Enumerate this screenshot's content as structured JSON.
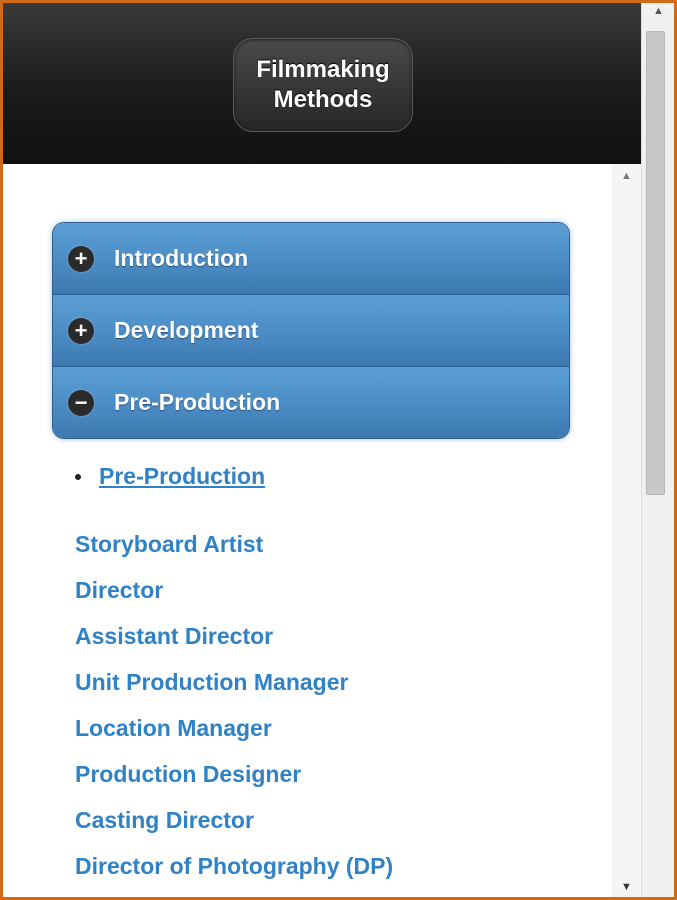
{
  "header": {
    "title": "Filmmaking\nMethods"
  },
  "accordion": [
    {
      "label": "Introduction",
      "icon": "plus-icon",
      "symbol": "+"
    },
    {
      "label": "Development",
      "icon": "plus-icon",
      "symbol": "+"
    },
    {
      "label": "Pre-Production",
      "icon": "minus-icon",
      "symbol": "−"
    }
  ],
  "content": {
    "bullet_link": "Pre-Production",
    "links": [
      "Storyboard Artist",
      "Director",
      "Assistant Director",
      "Unit Production Manager",
      "Location Manager",
      "Production Designer",
      "Casting Director",
      "Director of Photography (DP)"
    ]
  },
  "scrollbar": {
    "up": "▲",
    "down": "▼"
  },
  "colors": {
    "frame": "#d06a16",
    "accordion": "#4c8dc6",
    "link": "#2f82c6"
  }
}
